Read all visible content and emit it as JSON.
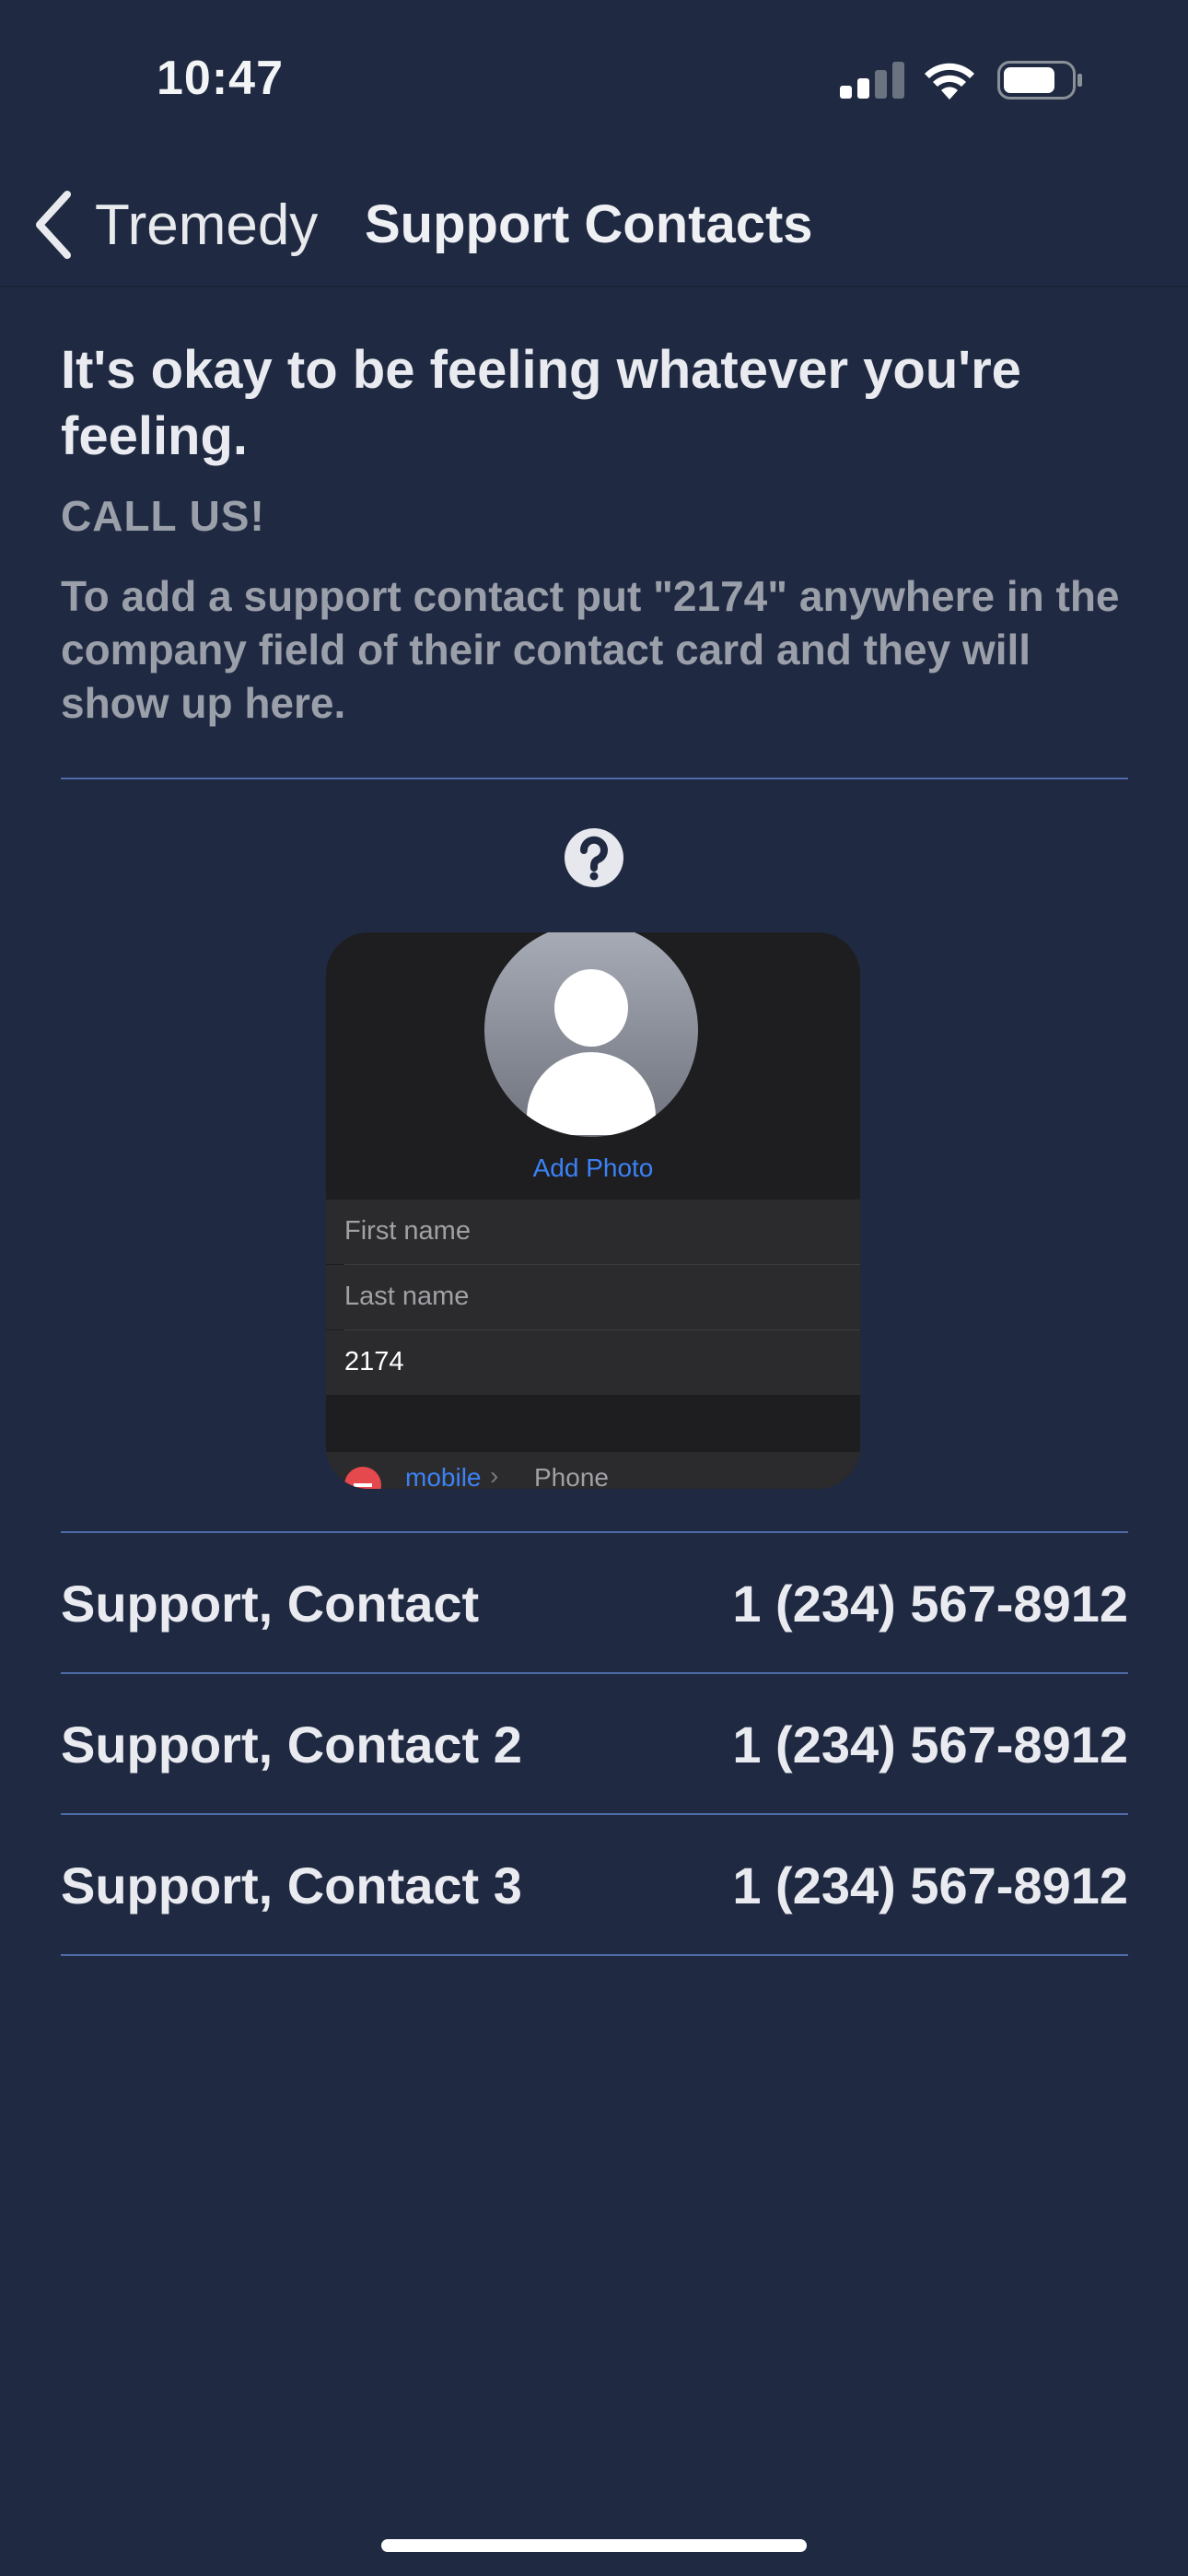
{
  "status_bar": {
    "time": "10:47"
  },
  "nav": {
    "back_label": "Tremedy",
    "title": "Support Contacts"
  },
  "main": {
    "headline": "It's okay to be feeling whatever you're feeling.",
    "call_label": "CALL US!",
    "instructions": "To add a support contact put \"2174\" anywhere in the company field of their contact card and they will show up here."
  },
  "preview_card": {
    "add_photo": "Add Photo",
    "first_name_placeholder": "First name",
    "last_name_placeholder": "Last name",
    "company_value": "2174",
    "phone_label": "mobile",
    "phone_chevron": "›",
    "phone_placeholder": "Phone"
  },
  "contacts": [
    {
      "name": "Support, Contact",
      "phone": "1 (234) 567-8912"
    },
    {
      "name": "Support, Contact 2",
      "phone": "1 (234) 567-8912"
    },
    {
      "name": "Support, Contact 3",
      "phone": "1 (234) 567-8912"
    }
  ],
  "colors": {
    "background": "#1f2a42",
    "divider": "#4e6aa8",
    "accent": "#3b82f6"
  }
}
